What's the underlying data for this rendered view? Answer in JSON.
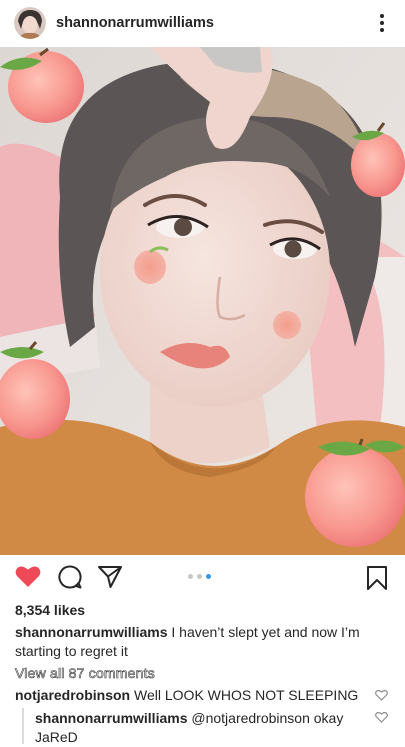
{
  "header": {
    "username": "shannonarrumwilliams"
  },
  "icons": {
    "more": "more-vertical-icon",
    "like": "heart-filled-icon",
    "comment": "comment-icon",
    "share": "direct-share-icon",
    "save": "bookmark-icon",
    "comment_like": "heart-outline-icon"
  },
  "colors": {
    "like_red": "#ed4956",
    "carousel_active": "#3897f0",
    "text": "#262626"
  },
  "carousel": {
    "total_slides": 3,
    "active_slide": 3
  },
  "post": {
    "likes": "8,354 likes",
    "caption_user": "shannonarrumwilliams",
    "caption_text": "I haven’t slept yet and now I’m starting to regret it",
    "view_all_comments": "View all 87 comments"
  },
  "comments": [
    {
      "user": "notjaredrobinson",
      "text": "Well LOOK WHOS NOT SLEEPING"
    },
    {
      "user": "shannonarrumwilliams",
      "text": "@notjaredrobinson okay JaReD"
    }
  ]
}
